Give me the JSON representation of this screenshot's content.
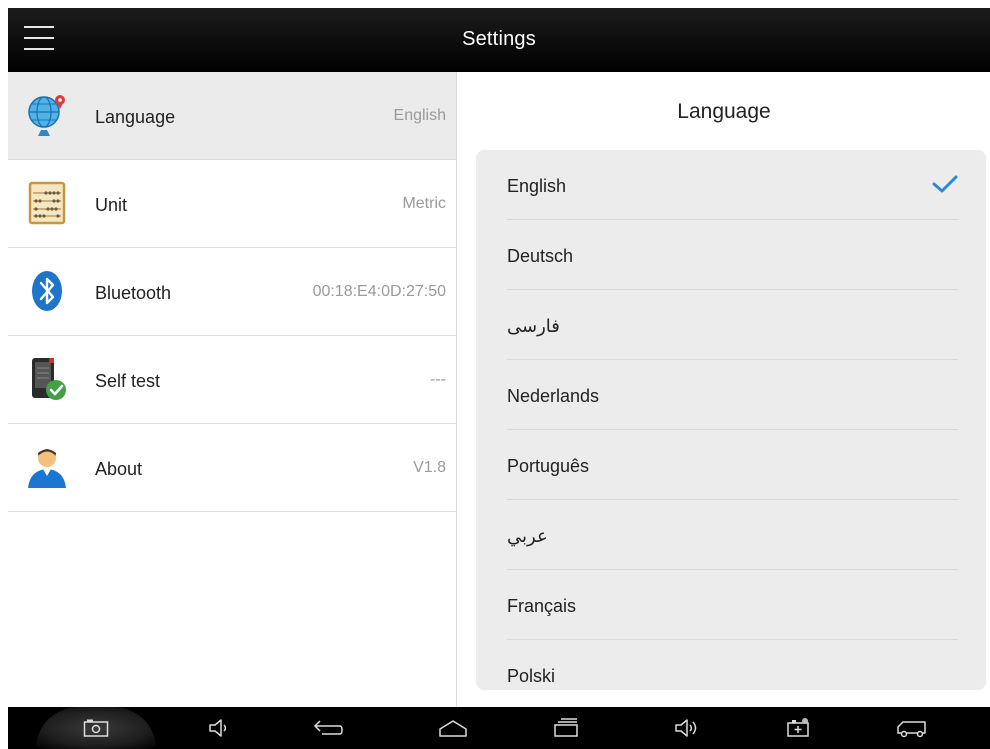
{
  "header": {
    "title": "Settings"
  },
  "settings": {
    "items": [
      {
        "label": "Language",
        "value": "English",
        "icon": "globe-icon"
      },
      {
        "label": "Unit",
        "value": "Metric",
        "icon": "abacus-icon"
      },
      {
        "label": "Bluetooth",
        "value": "00:18:E4:0D:27:50",
        "icon": "bluetooth-icon"
      },
      {
        "label": "Self test",
        "value": "---",
        "icon": "device-check-icon"
      },
      {
        "label": "About",
        "value": "V1.8",
        "icon": "user-icon"
      }
    ]
  },
  "language_panel": {
    "title": "Language",
    "selected": "English",
    "options": [
      "English",
      "Deutsch",
      "فارسی",
      "Nederlands",
      "Português",
      "عربي",
      "Français",
      "Polski"
    ]
  },
  "navbar": {
    "items": [
      "screenshot-icon",
      "volume-down-icon",
      "back-icon",
      "home-icon",
      "recent-apps-icon",
      "volume-up-icon",
      "battery-icon",
      "vehicle-icon"
    ]
  },
  "colors": {
    "accent": "#2a8ad8",
    "titlebar": "#000000",
    "selected_row": "#ebebeb",
    "card": "#ececec"
  }
}
